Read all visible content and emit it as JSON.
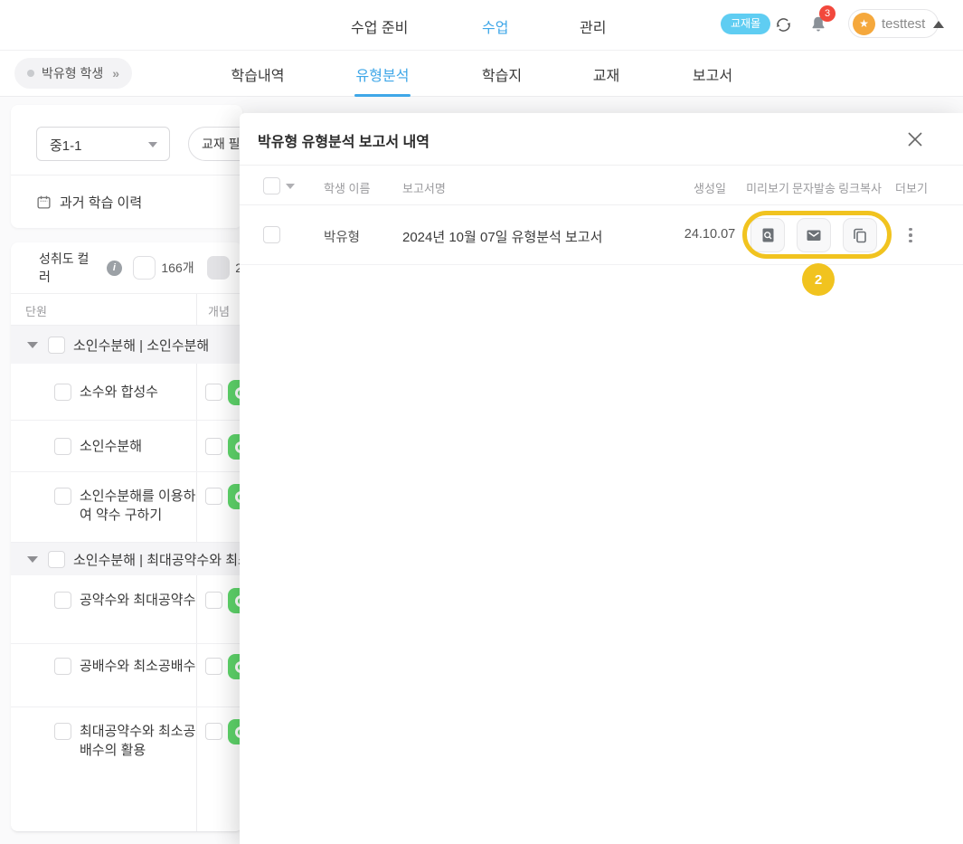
{
  "top_nav": {
    "items": [
      {
        "label": "수업 준비",
        "active": false
      },
      {
        "label": "수업",
        "active": true
      },
      {
        "label": "관리",
        "active": false
      }
    ],
    "store_badge": "교재몰",
    "notification_count": "3",
    "user_name": "testtest",
    "user_avatar_star": "★"
  },
  "sub_nav": {
    "student_chip": {
      "label": "박유형 학생",
      "chevron": "»"
    },
    "tabs": [
      {
        "label": "학습내역",
        "active": false
      },
      {
        "label": "유형분석",
        "active": true
      },
      {
        "label": "학습지",
        "active": false
      },
      {
        "label": "교재",
        "active": false
      },
      {
        "label": "보고서",
        "active": false
      }
    ]
  },
  "left_panel": {
    "grade_select_value": "중1-1",
    "textbook_filter_label": "교재 필터",
    "past_history_label": "과거 학습 이력",
    "achievement": {
      "label": "성취도 컬러",
      "info_glyph": "i",
      "count_white": "166개",
      "count_gray": "2"
    },
    "table": {
      "col_unit": "단원",
      "col_concept": "개념",
      "section1": {
        "title": "소인수분해 | 소인수분해",
        "rows": [
          "소수와 합성수",
          "소인수분해",
          "소인수분해를 이용하여 약수 구하기"
        ]
      },
      "section2": {
        "title": "소인수분해 | 최대공약수와 최소공",
        "rows": [
          "공약수와 최대공약수",
          "공배수와 최소공배수",
          "최대공약수와 최소공배수의 활용"
        ]
      }
    }
  },
  "modal": {
    "title": "박유형 유형분석 보고서 내역",
    "columns": {
      "student": "학생 이름",
      "report": "보고서명",
      "created": "생성일",
      "preview": "미리보기",
      "sms": "문자발송",
      "copy_link": "링크복사",
      "more": "더보기"
    },
    "row": {
      "student": "박유형",
      "report": "2024년 10월 07일 유형분석 보고서",
      "created": "24.10.07"
    },
    "highlight_badge": "2"
  },
  "colors": {
    "accent_blue": "#3FA7E8",
    "store_badge_cyan": "#5FCDF2",
    "alert_red": "#F2483C",
    "avatar_orange": "#F5A83C",
    "highlight_yellow": "#F1C31F",
    "achievement_green": "#5ED46A"
  }
}
